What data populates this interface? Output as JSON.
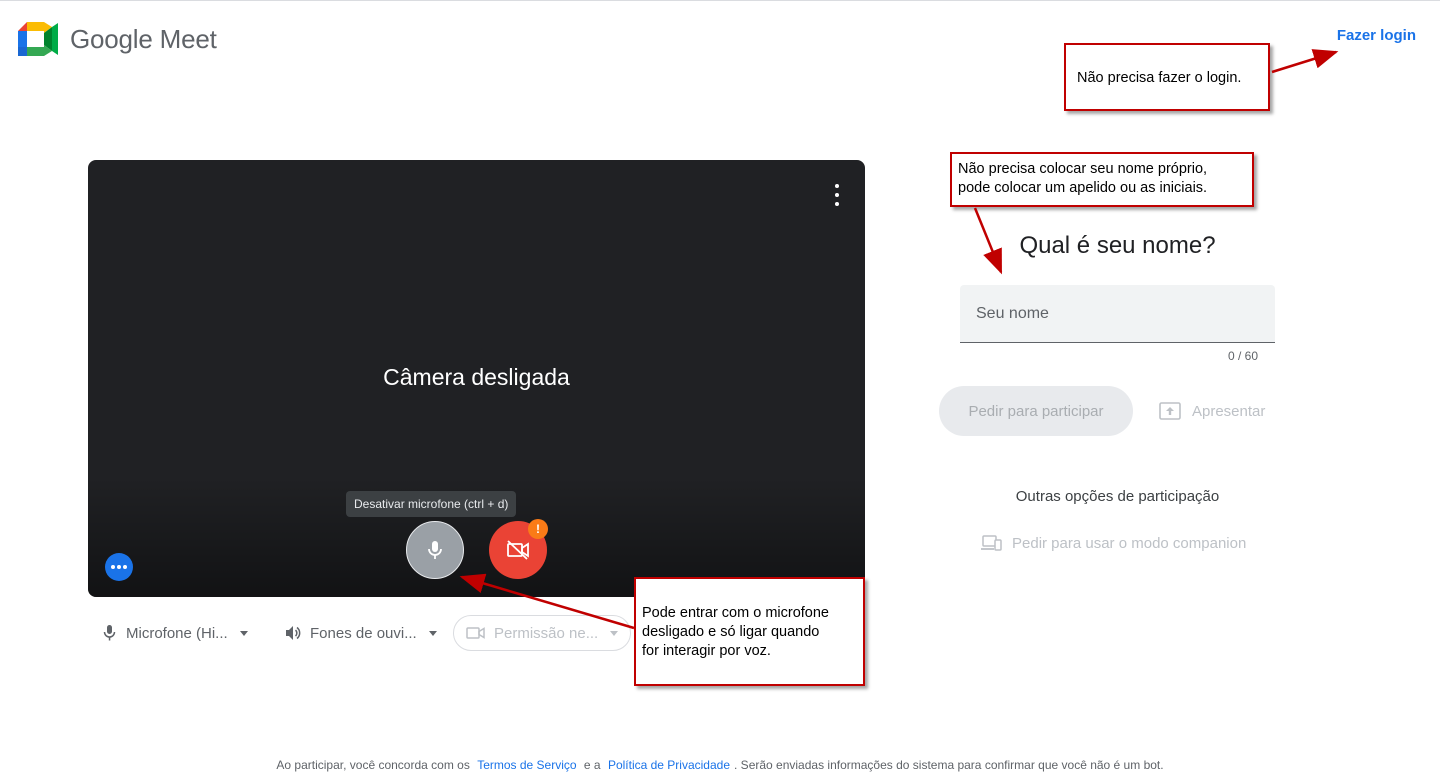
{
  "header": {
    "app_title": "Google Meet",
    "login_link": "Fazer login"
  },
  "preview": {
    "status_text": "Câmera desligada",
    "mic_tooltip": "Desativar microfone (ctrl + d)",
    "warning_badge": "!"
  },
  "devices": {
    "microphone": "Microfone (Hi...",
    "speaker": "Fones de ouvi...",
    "camera": "Permissão ne..."
  },
  "join": {
    "title": "Qual é seu nome?",
    "name_placeholder": "Seu nome",
    "char_count": "0 / 60",
    "ask_button": "Pedir para participar",
    "present_button": "Apresentar",
    "other_options_title": "Outras opções de participação",
    "companion_button": "Pedir para usar o modo companion"
  },
  "footer": {
    "text_before": "Ao participar, você concorda com os",
    "terms_link": "Termos de Serviço",
    "and_text": "e a",
    "privacy_link": "Política de Privacidade",
    "text_after": ". Serão enviadas informações do sistema para confirmar que você não é um bot."
  },
  "annotations": {
    "login_note": "Não precisa fazer o login.",
    "name_note_line1": "Não precisa colocar seu nome próprio,",
    "name_note_line2": "pode colocar um apelido ou as iniciais.",
    "mic_note_line1": "Pode entrar com o microfone",
    "mic_note_line2": "desligado e só ligar quando",
    "mic_note_line3": "for interagir por voz."
  },
  "colors": {
    "accent": "#1a73e8",
    "camera_off_red": "#ea4335",
    "annotation_red": "#c00000",
    "preview_bg": "#202124"
  }
}
